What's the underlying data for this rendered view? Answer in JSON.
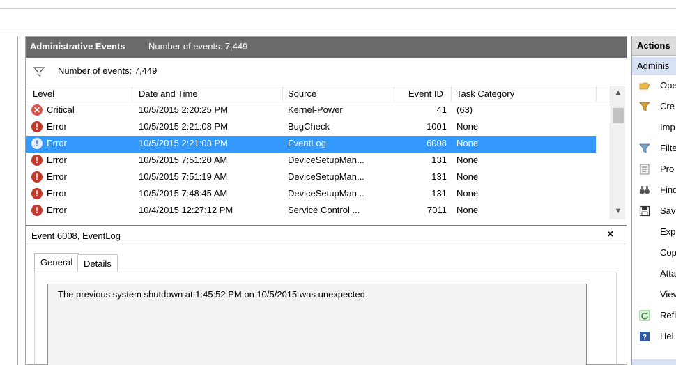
{
  "event_list": {
    "title": "Administrative Events",
    "count_label": "Number of events: 7,449",
    "filter_text": "Number of events: 7,449",
    "columns": [
      "Level",
      "Date and Time",
      "Source",
      "Event ID",
      "Task Category"
    ],
    "rows": [
      {
        "level": "Critical",
        "date": "10/5/2015 2:20:25 PM",
        "source": "Kernel-Power",
        "event_id": "41",
        "task": "(63)"
      },
      {
        "level": "Error",
        "date": "10/5/2015 2:21:08 PM",
        "source": "BugCheck",
        "event_id": "1001",
        "task": "None"
      },
      {
        "level": "Error",
        "date": "10/5/2015 2:21:03 PM",
        "source": "EventLog",
        "event_id": "6008",
        "task": "None"
      },
      {
        "level": "Error",
        "date": "10/5/2015 7:51:20 AM",
        "source": "DeviceSetupMan...",
        "event_id": "131",
        "task": "None"
      },
      {
        "level": "Error",
        "date": "10/5/2015 7:51:19 AM",
        "source": "DeviceSetupMan...",
        "event_id": "131",
        "task": "None"
      },
      {
        "level": "Error",
        "date": "10/5/2015 7:48:45 AM",
        "source": "DeviceSetupMan...",
        "event_id": "131",
        "task": "None"
      },
      {
        "level": "Error",
        "date": "10/4/2015 12:27:12 PM",
        "source": "Service Control ...",
        "event_id": "7011",
        "task": "None"
      }
    ]
  },
  "detail": {
    "title": "Event 6008, EventLog",
    "close_glyph": "×",
    "tabs": [
      "General",
      "Details"
    ],
    "message": "The previous system shutdown at 1:45:52 PM on 10/5/2015 was unexpected."
  },
  "actions": {
    "title": "Actions",
    "section": "Adminis",
    "items": [
      {
        "label": "Ope",
        "icon": "open-folder-icon"
      },
      {
        "label": "Cre",
        "icon": "create-filter-icon"
      },
      {
        "label": "Imp",
        "icon": ""
      },
      {
        "label": "Filte",
        "icon": "filter-icon"
      },
      {
        "label": "Pro",
        "icon": "properties-icon"
      },
      {
        "label": "Find",
        "icon": "find-binoculars-icon"
      },
      {
        "label": "Sav",
        "icon": "save-icon"
      },
      {
        "label": "Exp",
        "icon": ""
      },
      {
        "label": "Cop",
        "icon": ""
      },
      {
        "label": "Atta",
        "icon": ""
      },
      {
        "label": "Viev",
        "icon": ""
      },
      {
        "label": "Refi",
        "icon": "refresh-icon"
      },
      {
        "label": "Hel",
        "icon": "help-icon"
      }
    ]
  },
  "colors": {
    "title_bar": "#6a6a6a",
    "selection": "#3399ff",
    "critical": "#d9534f",
    "error": "#c0392b",
    "actions_subheader": "#d7e3f4"
  }
}
